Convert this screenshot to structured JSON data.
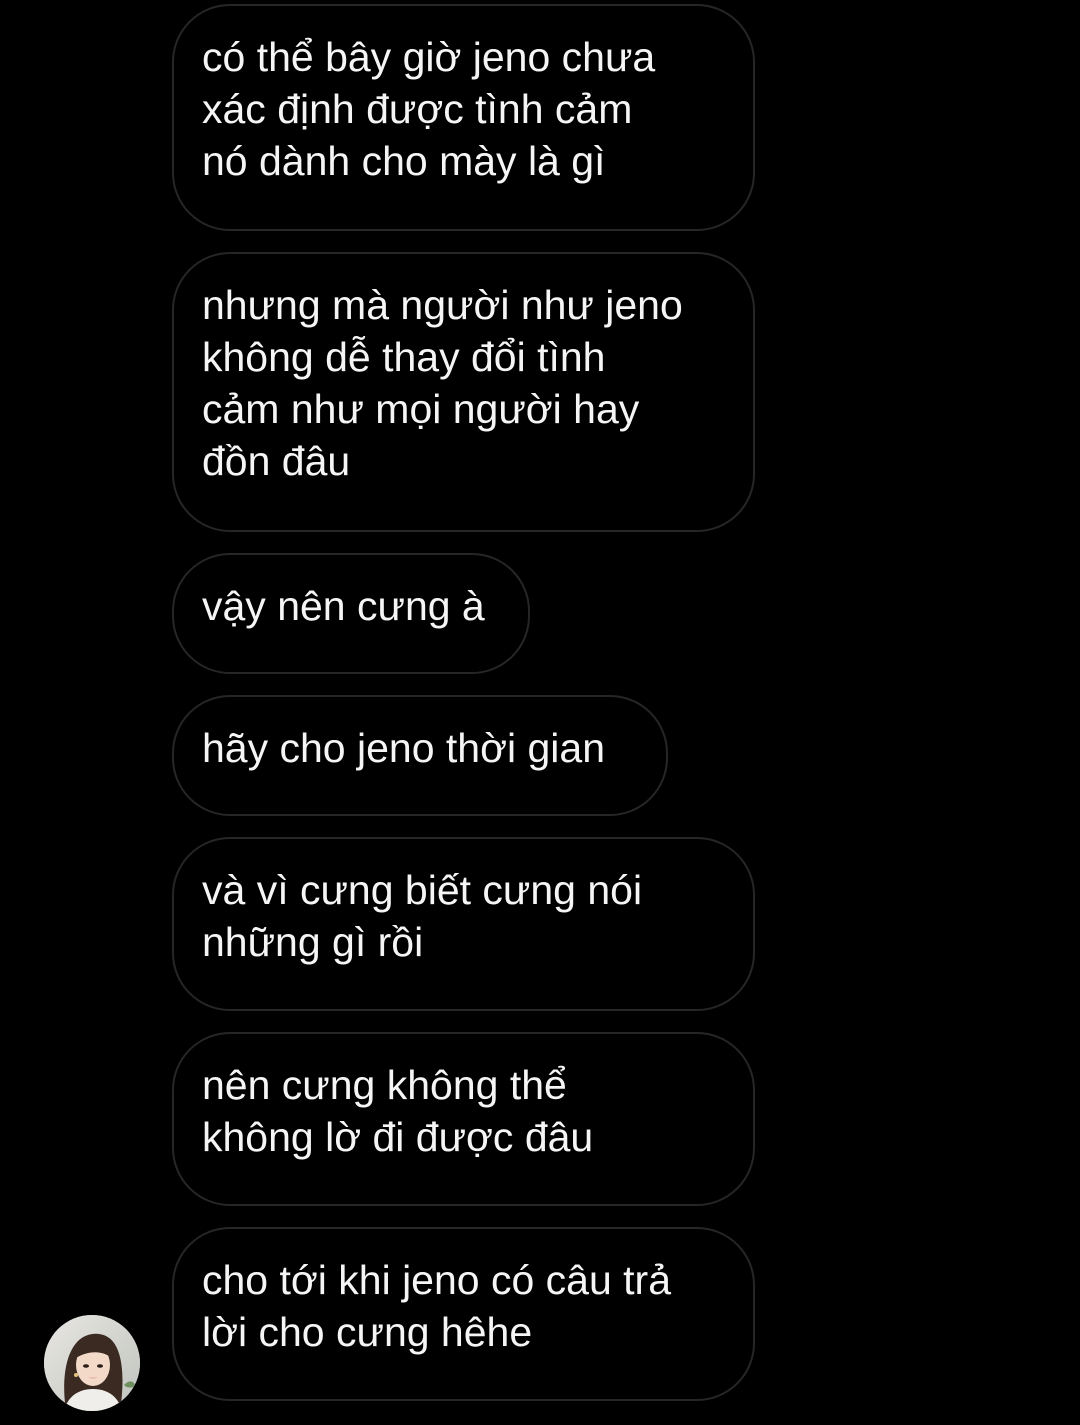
{
  "chat": {
    "messages": [
      {
        "text": "có thể bây giờ jeno chưa\nxác định được tình cảm\nnó dành cho mày là gì"
      },
      {
        "text": "nhưng mà người như jeno\nkhông dễ thay đổi tình\ncảm như mọi người hay\nđồn đâu"
      },
      {
        "text": "vậy nên cưng à"
      },
      {
        "text": "hãy cho jeno thời gian"
      },
      {
        "text": "và vì cưng biết cưng nói\nnhững gì rồi"
      },
      {
        "text": "nên cưng không thể\nkhông lờ đi được đâu"
      },
      {
        "text": "cho tới khi jeno có câu trả\nlời cho cưng hêhe"
      }
    ],
    "sender": {
      "avatar_icon": "contact-avatar-photo"
    }
  },
  "colors": {
    "background": "#000000",
    "bubble_border": "#262626",
    "text": "#f5f5f5"
  }
}
